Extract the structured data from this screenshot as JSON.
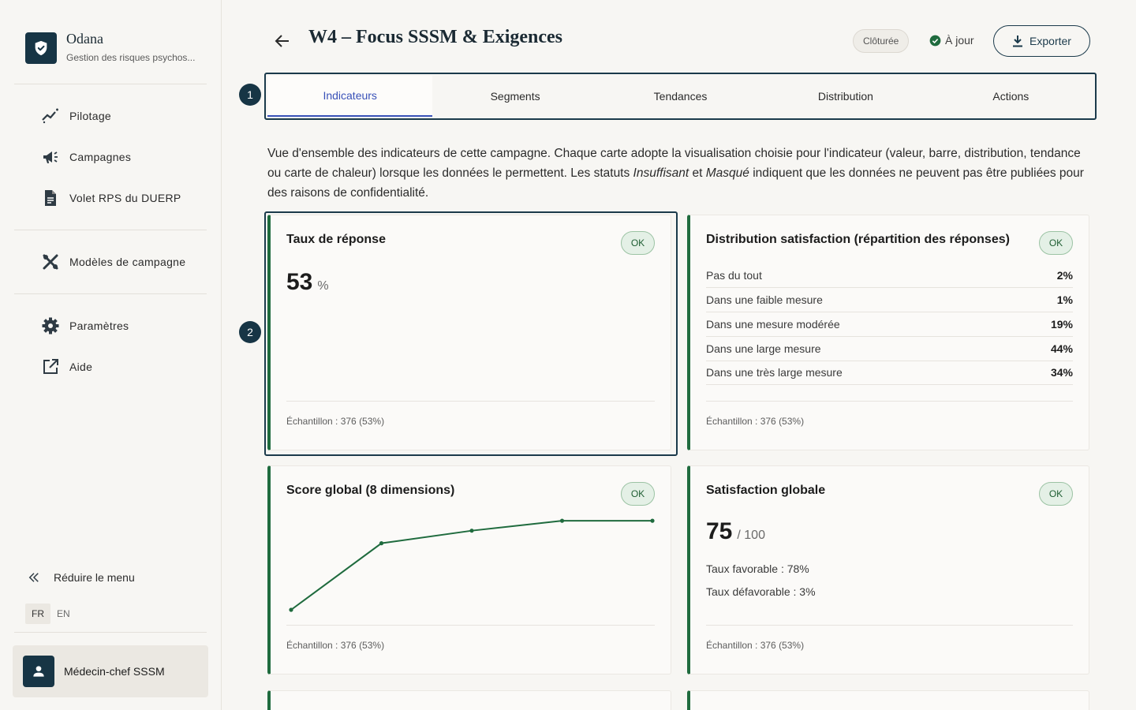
{
  "app": {
    "name": "Odana",
    "subtitle": "Gestion des risques psychos..."
  },
  "sidebar": {
    "items": [
      {
        "label": "Pilotage",
        "icon": "chart-line-icon"
      },
      {
        "label": "Campagnes",
        "icon": "megaphone-icon"
      },
      {
        "label": "Volet RPS du DUERP",
        "icon": "document-icon"
      },
      {
        "label": "Modèles de campagne",
        "icon": "tools-icon"
      },
      {
        "label": "Paramètres",
        "icon": "gear-icon"
      },
      {
        "label": "Aide",
        "icon": "external-link-icon"
      }
    ],
    "collapse_label": "Réduire le menu",
    "languages": [
      "FR",
      "EN"
    ],
    "active_language": "FR",
    "user": "Médecin-chef SSSM"
  },
  "header": {
    "title": "W4 – Focus SSSM & Exigences",
    "badge": "Clôturée",
    "status": "À jour",
    "export_label": "Exporter"
  },
  "steps": [
    "1",
    "2"
  ],
  "tabs": [
    {
      "label": "Indicateurs",
      "active": true
    },
    {
      "label": "Segments",
      "active": false
    },
    {
      "label": "Tendances",
      "active": false
    },
    {
      "label": "Distribution",
      "active": false
    },
    {
      "label": "Actions",
      "active": false
    }
  ],
  "intro": {
    "part1": "Vue d'ensemble des indicateurs de cette campagne. Chaque carte adopte la visualisation choisie pour l'indicateur (valeur, barre, distribution, tendance ou carte de chaleur) lorsque les données le permettent. Les statuts ",
    "em1": "Insuffisant",
    "part2": " et ",
    "em2": "Masqué",
    "part3": " indiquent que les données ne peuvent pas être publiées pour des raisons de confidentialité."
  },
  "cards": {
    "response_rate": {
      "title": "Taux de réponse",
      "status": "OK",
      "value": "53",
      "unit": "%",
      "footer": "Échantillon : 376 (53%)"
    },
    "distribution": {
      "title": "Distribution satisfaction (répartition des réponses)",
      "status": "OK",
      "rows": [
        {
          "label": "Pas du tout",
          "value": "2%"
        },
        {
          "label": "Dans une faible mesure",
          "value": "1%"
        },
        {
          "label": "Dans une mesure modérée",
          "value": "19%"
        },
        {
          "label": "Dans une large mesure",
          "value": "44%"
        },
        {
          "label": "Dans une très large mesure",
          "value": "34%"
        }
      ],
      "footer": "Échantillon : 376 (53%)"
    },
    "global_score": {
      "title": "Score global (8 dimensions)",
      "status": "OK",
      "footer": "Échantillon : 376 (53%)"
    },
    "satisfaction": {
      "title": "Satisfaction globale",
      "status": "OK",
      "value": "75",
      "unit": "/ 100",
      "favorable": "Taux favorable : 78%",
      "unfavorable": "Taux défavorable : 3%",
      "footer": "Échantillon : 376 (53%)"
    }
  },
  "chart_data": {
    "type": "line",
    "title": "Score global (8 dimensions)",
    "values": [
      0.0,
      0.74,
      0.88,
      0.99,
      0.99
    ],
    "color": "#1f6b3e"
  },
  "colors": {
    "accent": "#1f6b3e",
    "primary": "#173545",
    "tab_active": "#3951b8"
  }
}
